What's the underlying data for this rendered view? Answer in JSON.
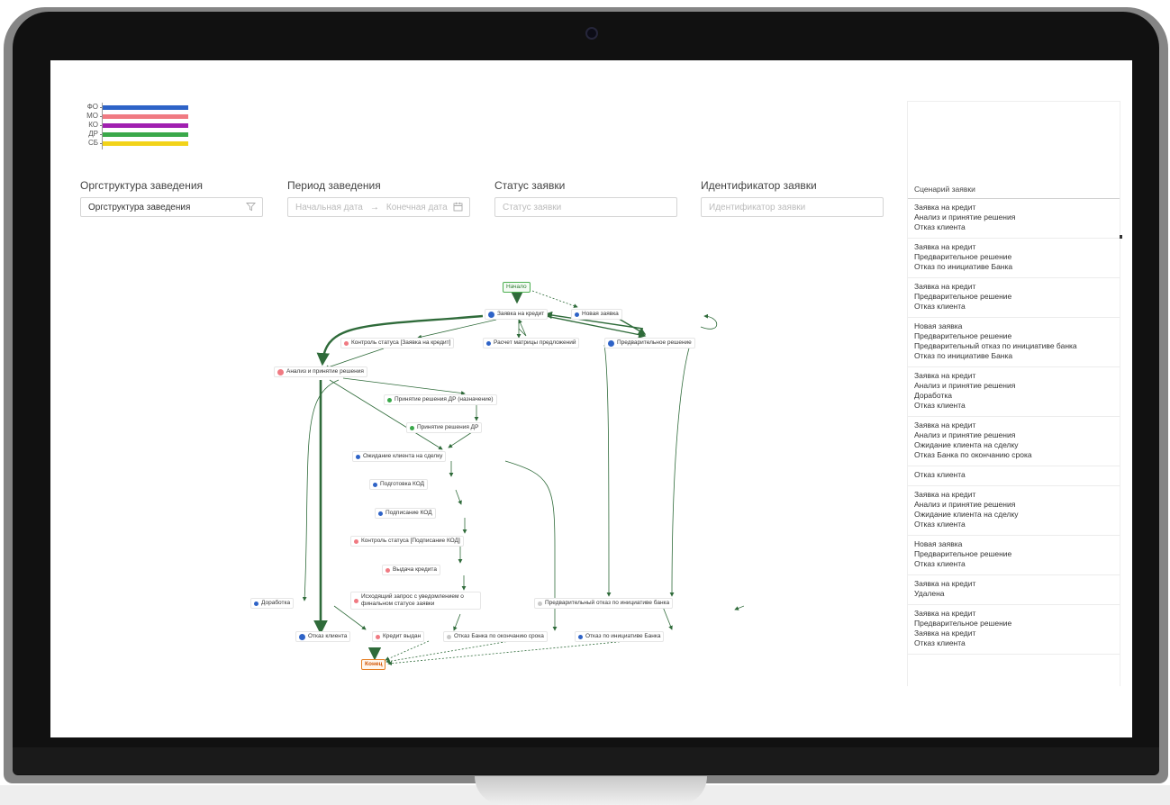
{
  "legend": [
    {
      "label": "ФО",
      "color": "#2e63c7"
    },
    {
      "label": "МО",
      "color": "#f07a82"
    },
    {
      "label": "КО",
      "color": "#a020b0"
    },
    {
      "label": "ДР",
      "color": "#3aa84a"
    },
    {
      "label": "СБ",
      "color": "#f2d31a"
    }
  ],
  "filters": {
    "org": {
      "title": "Оргструктура заведения",
      "value": "Оргструктура заведения",
      "icon": "filter-icon"
    },
    "period": {
      "title": "Период заведения",
      "start_placeholder": "Начальная дата",
      "end_placeholder": "Конечная дата",
      "icon": "calendar-icon"
    },
    "status": {
      "title": "Статус заявки",
      "placeholder": "Статус заявки"
    },
    "id": {
      "title": "Идентификатор заявки",
      "placeholder": "Идентификатор заявки"
    }
  },
  "diagram": {
    "start": "Начало",
    "end": "Конец",
    "nodes": {
      "credit_request": "Заявка на кредит",
      "new_request": "Новая заявка",
      "status_control_request": "Контроль статуса [Заявка на кредит]",
      "offer_matrix": "Расчет матрицы предложений",
      "preliminary_decision": "Предварительное решение",
      "analysis_decision": "Анализ и принятие решения",
      "dr_decision_assign": "Принятие решения ДР (назначение)",
      "dr_decision": "Принятие решения ДР",
      "waiting_client": "Ожидание клиента на сделку",
      "kod_preparation": "Подготовка КОД",
      "kod_signing": "Подписание КОД",
      "status_control_kod": "Контроль статуса [Подписание КОД]",
      "credit_issue": "Выдача кредита",
      "outgoing_request": "Исходящий запрос с уведомлением о финальном статусе заявки",
      "rework": "Доработка",
      "prelim_bank_refusal": "Предварительный отказ по инициативе банка",
      "client_refusal": "Отказ клиента",
      "credit_issued": "Кредит выдан",
      "bank_refusal_timeout": "Отказ Банка по окончанию срока",
      "bank_refusal": "Отказ по инициативе Банка"
    }
  },
  "scenarios": {
    "header": "Сценарий заявки",
    "items": [
      [
        "Заявка на кредит",
        "Анализ и принятие решения",
        "Отказ клиента"
      ],
      [
        "Заявка на кредит",
        "Предварительное решение",
        "Отказ по инициативе Банка"
      ],
      [
        "Заявка на кредит",
        "Предварительное решение",
        "Отказ клиента"
      ],
      [
        "Новая заявка",
        "Предварительное решение",
        "Предварительный отказ по инициативе банка",
        "Отказ по инициативе Банка"
      ],
      [
        "Заявка на кредит",
        "Анализ и принятие решения",
        "Доработка",
        "Отказ клиента"
      ],
      [
        "Заявка на кредит",
        "Анализ и принятие решения",
        "Ожидание клиента на сделку",
        "Отказ Банка по окончанию срока"
      ],
      [
        "Отказ клиента"
      ],
      [
        "Заявка на кредит",
        "Анализ и принятие решения",
        "Ожидание клиента на сделку",
        "Отказ клиента"
      ],
      [
        "Новая заявка",
        "Предварительное решение",
        "Отказ клиента"
      ],
      [
        "Заявка на кредит",
        "Удалена"
      ],
      [
        "Заявка на кредит",
        "Предварительное решение",
        "Заявка на кредит",
        "Отказ клиента"
      ]
    ]
  },
  "colors": {
    "edge": "#2f6b3a",
    "dot_blue": "#2e63c7",
    "dot_red": "#f07a82",
    "dot_green": "#3aa84a",
    "dot_gray": "#c8c8c8"
  }
}
